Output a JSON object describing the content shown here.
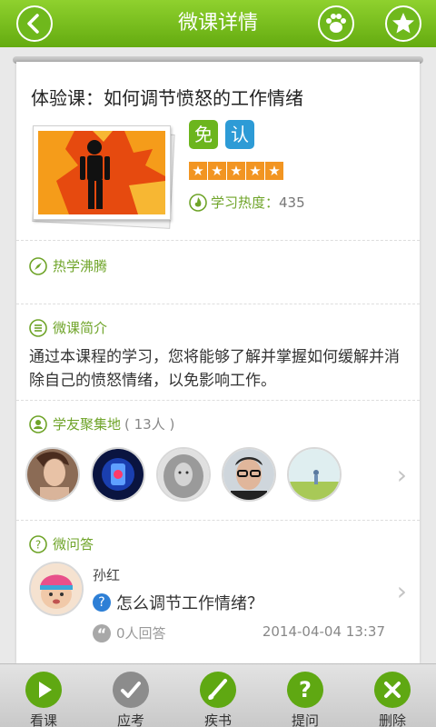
{
  "header": {
    "title": "微课详情"
  },
  "course": {
    "title": "体验课：如何调节愤怒的工作情绪",
    "badges": {
      "free": "免",
      "cert": "认"
    },
    "rating": 5,
    "heat_label": "学习热度：",
    "heat_value": "435"
  },
  "sections": {
    "hot": {
      "title": "热学沸腾"
    },
    "intro": {
      "title": "微课简介",
      "text": "通过本课程的学习，您将能够了解并掌握如何缓解并消除自己的愤怒情绪，以免影响工作。"
    },
    "classmates": {
      "title": "学友聚集地",
      "count": "( 13人 )"
    },
    "qa": {
      "title": "微问答",
      "user": "孙红",
      "question": "怎么调节工作情绪？",
      "answers": "0人回答",
      "time": "2014-04-04  13:37"
    }
  },
  "nav": {
    "items": [
      {
        "label": "看课",
        "color": "#5fa812"
      },
      {
        "label": "应考",
        "color": "#8c8c8c"
      },
      {
        "label": "疾书",
        "color": "#5fa812"
      },
      {
        "label": "提问",
        "color": "#5fa812"
      },
      {
        "label": "删除",
        "color": "#5fa812"
      }
    ]
  },
  "colors": {
    "accent": "#6cb51d",
    "header": "#7dc21f",
    "star": "#f29522",
    "cert": "#2d9bd6"
  }
}
